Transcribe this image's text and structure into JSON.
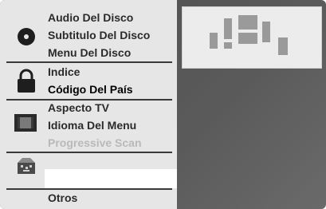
{
  "menu": {
    "groups": [
      {
        "icon": "disc-icon",
        "items": [
          {
            "label": "Audio Del Disco",
            "state": "normal"
          },
          {
            "label": "Subtitulo Del Disco",
            "state": "normal"
          },
          {
            "label": "Menu Del Disco",
            "state": "normal"
          }
        ]
      },
      {
        "icon": "lock-icon",
        "items": [
          {
            "label": "Indice",
            "state": "normal"
          },
          {
            "label": "Código Del País",
            "state": "selected"
          }
        ]
      },
      {
        "icon": "tv-screen-icon",
        "items": [
          {
            "label": "Aspecto TV",
            "state": "normal"
          },
          {
            "label": "Idioma Del Menu",
            "state": "normal"
          },
          {
            "label": "Progressive Scan",
            "state": "disabled"
          }
        ]
      },
      {
        "icon": "speaker-icon",
        "items": []
      },
      {
        "icon": "",
        "items": [
          {
            "label": "Otros",
            "state": "normal"
          }
        ]
      }
    ]
  },
  "colors": {
    "menu_background": "#e6e6e6",
    "text": "#2b2b2b",
    "disabled_text": "#b9b9b9",
    "divider": "#3a3a3a",
    "screen_background": "#565656"
  },
  "preview": {
    "icon": "country-code-preview-icon"
  }
}
